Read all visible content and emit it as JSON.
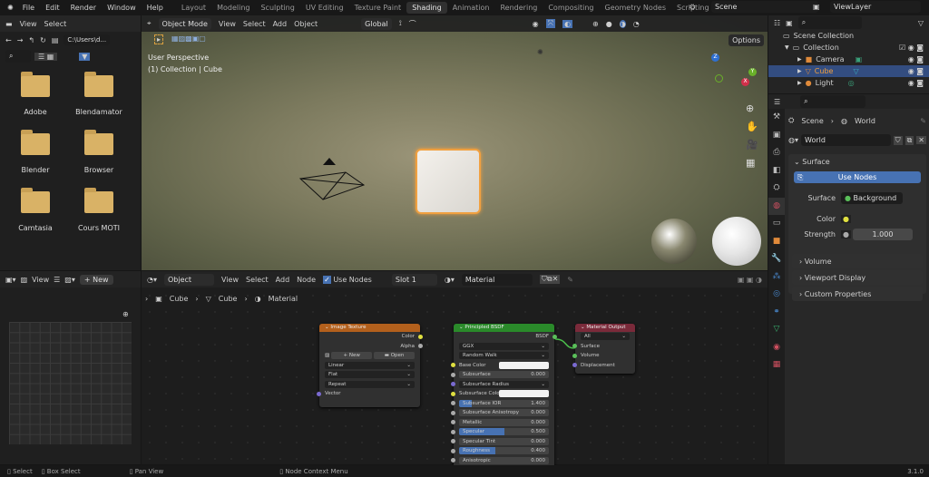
{
  "menu": {
    "items": [
      "File",
      "Edit",
      "Render",
      "Window",
      "Help"
    ]
  },
  "workspaces": {
    "tabs": [
      "Layout",
      "Modeling",
      "Sculpting",
      "UV Editing",
      "Texture Paint",
      "Shading",
      "Animation",
      "Rendering",
      "Compositing",
      "Geometry Nodes",
      "Scripting"
    ],
    "active": "Shading",
    "add": "+"
  },
  "scene": {
    "name": "Scene",
    "view_layer": "ViewLayer"
  },
  "file_browser": {
    "menu": [
      "View",
      "Select"
    ],
    "path": "C:\\Users\\d...",
    "folders": [
      "Adobe",
      "Blendamator",
      "Blender",
      "Browser",
      "Camtasia",
      "Cours MOTI"
    ]
  },
  "viewport": {
    "mode": "Object Mode",
    "menu": [
      "View",
      "Select",
      "Add",
      "Object"
    ],
    "orientation": "Global",
    "options": "Options",
    "info_line1": "User Perspective",
    "info_line2": "(1) Collection | Cube",
    "gizmo_axes": [
      "X",
      "Y",
      "Z"
    ]
  },
  "outliner": {
    "root": "Scene Collection",
    "collection": "Collection",
    "items": [
      {
        "name": "Camera",
        "selected": false
      },
      {
        "name": "Cube",
        "selected": true
      },
      {
        "name": "Light",
        "selected": false
      }
    ]
  },
  "properties": {
    "breadcrumb": [
      "Scene",
      "World"
    ],
    "world_name": "World",
    "surface_section": "Surface",
    "use_nodes": "Use Nodes",
    "surface_label": "Surface",
    "surface_value": "Background",
    "color_label": "Color",
    "strength_label": "Strength",
    "strength_value": "1.000",
    "sections": [
      "Volume",
      "Viewport Display",
      "Custom Properties"
    ]
  },
  "image_editor": {
    "view": "View",
    "new": "New"
  },
  "node_editor": {
    "type": "Object",
    "menu": [
      "View",
      "Select",
      "Add",
      "Node"
    ],
    "use_nodes": "Use Nodes",
    "use_nodes_checked": true,
    "slot": "Slot 1",
    "material": "Material",
    "breadcrumb": [
      "Cube",
      "Cube",
      "Material"
    ]
  },
  "nodes": {
    "image_texture": {
      "title": "Image Texture",
      "outputs": [
        "Color",
        "Alpha"
      ],
      "new": "New",
      "open": "Open",
      "interpolation": "Linear",
      "projection": "Flat",
      "extension": "Repeat",
      "input": "Vector",
      "color": "#b3601c"
    },
    "bsdf": {
      "title": "Principled BSDF",
      "output": "BSDF",
      "distribution": "GGX",
      "subsurface_method": "Random Walk",
      "base_color": "Base Color",
      "subsurface_radius": "Subsurface Radius",
      "subsurface_color": "Subsurface Colo",
      "fields": [
        {
          "label": "Subsurface",
          "value": "0.000",
          "fill": 0
        },
        {
          "label": "Subsurface IOR",
          "value": "1.400",
          "fill": 0.14
        },
        {
          "label": "Subsurface Anisotropy",
          "value": "0.000",
          "fill": 0
        },
        {
          "label": "Metallic",
          "value": "0.000",
          "fill": 0
        },
        {
          "label": "Specular",
          "value": "0.500",
          "fill": 0.5
        },
        {
          "label": "Specular Tint",
          "value": "0.000",
          "fill": 0
        },
        {
          "label": "Roughness",
          "value": "0.400",
          "fill": 0.4
        },
        {
          "label": "Anisotropic",
          "value": "0.000",
          "fill": 0
        }
      ],
      "color": "#2a8a2a"
    },
    "output": {
      "title": "Material Output",
      "target": "All",
      "inputs": [
        "Surface",
        "Volume",
        "Displacement"
      ],
      "color": "#7a2a3a"
    }
  },
  "status": {
    "select": "Select",
    "box_select": "Box Select",
    "pan": "Pan View",
    "context": "Node Context Menu",
    "version": "3.1.0"
  }
}
